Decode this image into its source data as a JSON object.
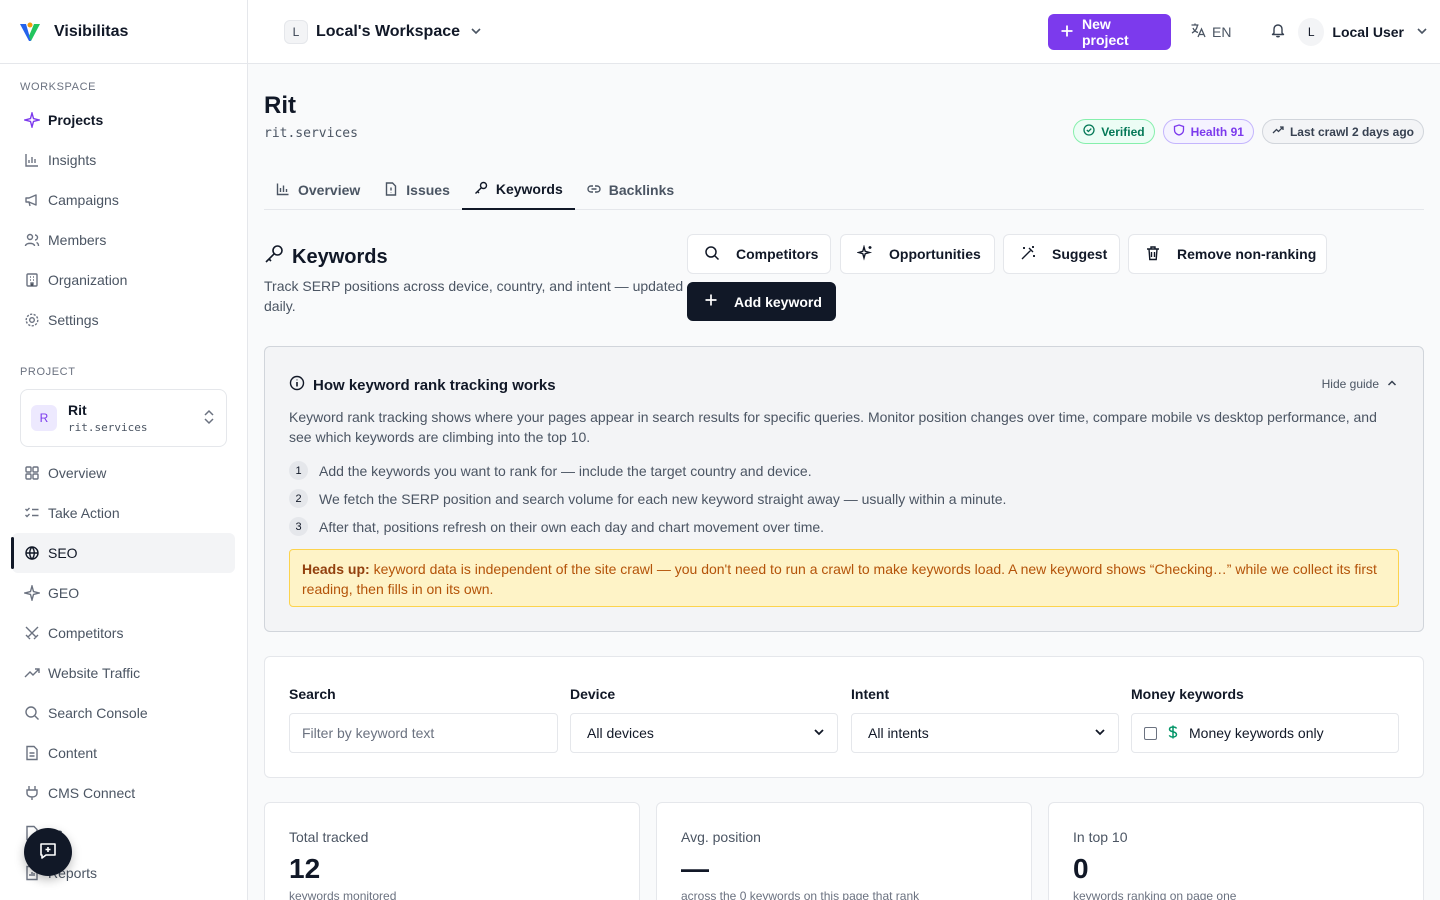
{
  "brand": {
    "name": "Visibilitas"
  },
  "sidebar": {
    "workspace_label": "WORKSPACE",
    "workspace_items": [
      {
        "label": "Projects"
      },
      {
        "label": "Insights"
      },
      {
        "label": "Campaigns"
      },
      {
        "label": "Members"
      },
      {
        "label": "Organization"
      },
      {
        "label": "Settings"
      }
    ],
    "project_label": "PROJECT",
    "project_card": {
      "initial": "R",
      "name": "Rit",
      "domain": "rit.services"
    },
    "project_items": [
      {
        "label": "Overview"
      },
      {
        "label": "Take Action"
      },
      {
        "label": "SEO"
      },
      {
        "label": "GEO"
      },
      {
        "label": "Competitors"
      },
      {
        "label": "Website Traffic"
      },
      {
        "label": "Search Console"
      },
      {
        "label": "Content"
      },
      {
        "label": "CMS Connect"
      },
      {
        "label": "es"
      },
      {
        "label": "Reports"
      }
    ]
  },
  "topbar": {
    "workspace_initial": "L",
    "workspace_name": "Local's Workspace",
    "new_project": "New project",
    "language": "EN",
    "user_initial": "L",
    "user_name": "Local User"
  },
  "page": {
    "title": "Rit",
    "domain": "rit.services",
    "badges": {
      "verified": "Verified",
      "health": "Health 91",
      "crawl": "Last crawl 2 days ago"
    },
    "tabs": [
      "Overview",
      "Issues",
      "Keywords",
      "Backlinks"
    ]
  },
  "keywords": {
    "title": "Keywords",
    "description": "Track SERP positions across device, country, and intent — updated daily.",
    "actions": {
      "competitors": "Competitors",
      "opportunities": "Opportunities",
      "suggest": "Suggest",
      "remove": "Remove non-ranking",
      "add": "Add keyword"
    }
  },
  "guide": {
    "title": "How keyword rank tracking works",
    "hide": "Hide guide",
    "intro": "Keyword rank tracking shows where your pages appear in search results for specific queries. Monitor position changes over time, compare mobile vs desktop performance, and see which keywords are climbing into the top 10.",
    "steps": [
      {
        "num": "1",
        "text": "Add the keywords you want to rank for — include the target country and device."
      },
      {
        "num": "2",
        "text": "We fetch the SERP position and search volume for each new keyword straight away — usually within a minute."
      },
      {
        "num": "3",
        "text": "After that, positions refresh on their own each day and chart movement over time."
      }
    ],
    "headsup_label": "Heads up:",
    "headsup_text": " keyword data is independent of the site crawl — you don't need to run a crawl to make keywords load. A new keyword shows “Checking…” while we collect its first reading, then fills in on its own."
  },
  "filters": {
    "search_label": "Search",
    "search_placeholder": "Filter by keyword text",
    "device_label": "Device",
    "device_value": "All devices",
    "intent_label": "Intent",
    "intent_value": "All intents",
    "money_label": "Money keywords",
    "money_value": "Money keywords only"
  },
  "stats": [
    {
      "label": "Total tracked",
      "value": "12",
      "sub": "keywords monitored"
    },
    {
      "label": "Avg. position",
      "value": "—",
      "sub": "across the 0 keywords on this page that rank"
    },
    {
      "label": "In top 10",
      "value": "0",
      "sub": "keywords ranking on page one"
    }
  ],
  "colors": {
    "accent": "#7c3aed",
    "dark": "#111827",
    "verified": "#047857",
    "warning": "#b45309"
  }
}
